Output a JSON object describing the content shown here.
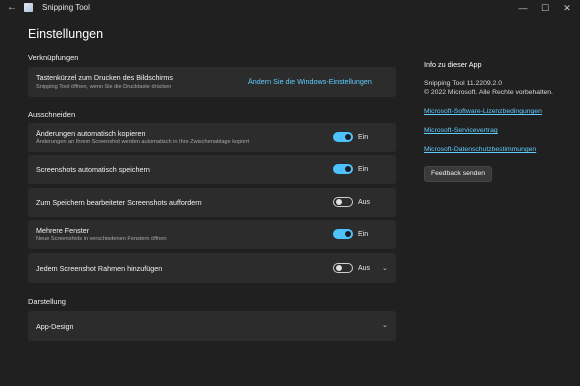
{
  "window": {
    "title": "Snipping Tool",
    "back_icon": "back-arrow-icon",
    "controls": {
      "minimize": "—",
      "maximize": "☐",
      "close": "✕"
    }
  },
  "page": {
    "title": "Einstellungen"
  },
  "sections": {
    "shortcuts": "Verknüpfungen",
    "cut": "Ausschneiden",
    "display": "Darstellung"
  },
  "shortcut_card": {
    "title": "Tastenkürzel zum Drucken des Bildschirms",
    "subtitle": "Snipping Tool öffnen, wenn Sie die Drucktaste drücken",
    "link": "Ändern Sie die Windows-Einstellungen"
  },
  "settings": [
    {
      "title": "Änderungen automatisch kopieren",
      "subtitle": "Änderungen an Ihrem Screenshot werden automatisch in Ihre Zwischenablage kopiert",
      "state": "Ein"
    },
    {
      "title": "Screenshots automatisch speichern",
      "subtitle": "",
      "state": "Ein"
    },
    {
      "title": "Zum Speichern bearbeiteter Screenshots auffordern",
      "subtitle": "",
      "state": "Aus"
    },
    {
      "title": "Mehrere Fenster",
      "subtitle": "Neue Screenshots in verschiedenen Fenstern öffnen",
      "state": "Ein"
    },
    {
      "title": "Jedem Screenshot Rahmen hinzufügen",
      "subtitle": "",
      "state": "Aus"
    }
  ],
  "display_card": {
    "title": "App-Design"
  },
  "about": {
    "heading": "Info zu dieser App",
    "version": "Snipping Tool 11.2209.2.0",
    "copyright": "© 2022 Microsoft. Alle Rechte vorbehalten.",
    "links": [
      "Microsoft-Software-Lizenzbedingungen",
      "Microsoft-Servicevertrag",
      "Microsoft-Datenschutzbestimmungen"
    ],
    "feedback_button": "Feedback senden"
  },
  "colors": {
    "accent": "#4cc2ff",
    "link": "#60cdff",
    "background": "#202020",
    "card": "#2c2c2c"
  }
}
